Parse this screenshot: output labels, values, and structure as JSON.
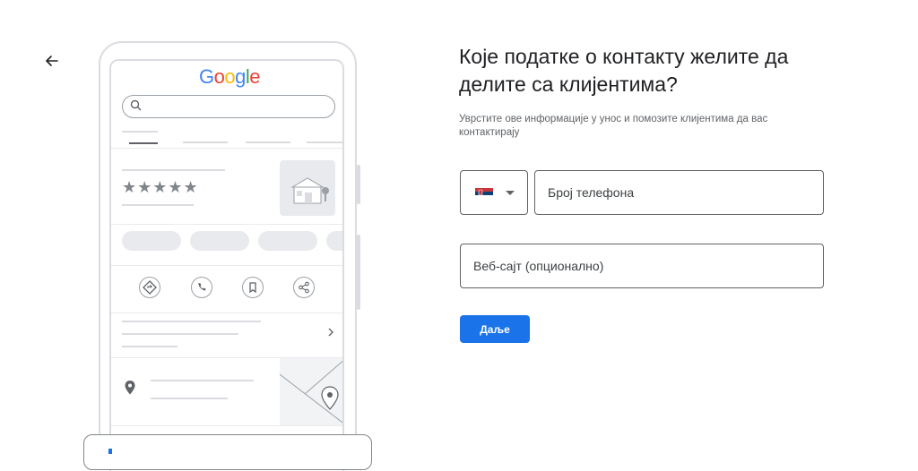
{
  "nav": {
    "back_icon": "arrow-back-icon"
  },
  "illustration": {
    "logo": "Google",
    "rating_stars": "★★★★★",
    "action_icons": [
      "directions-icon",
      "phone-icon",
      "bookmark-icon",
      "share-icon"
    ],
    "location_icon": "location-pin-icon",
    "chevron_icon": "chevron-right-icon"
  },
  "form": {
    "heading": "Које податке о контакту желите да делите са клијентима?",
    "subtext": "Уврстите ове информације у унос и помозите клијентима да вас контактирају",
    "country_select": {
      "flag_icon": "serbia-flag-icon",
      "dropdown_icon": "arrow-drop-down-icon"
    },
    "phone": {
      "placeholder": "Број телефона",
      "value": ""
    },
    "website": {
      "placeholder": "Веб-сајт (опционално)",
      "value": ""
    },
    "next_label": "Даље"
  },
  "colors": {
    "accent": "#1a73e8",
    "google_blue": "#4285F4",
    "google_red": "#EA4335",
    "google_yellow": "#FBBC05",
    "google_green": "#34A853",
    "flag_red": "#C6363C",
    "flag_blue": "#0C4076"
  }
}
